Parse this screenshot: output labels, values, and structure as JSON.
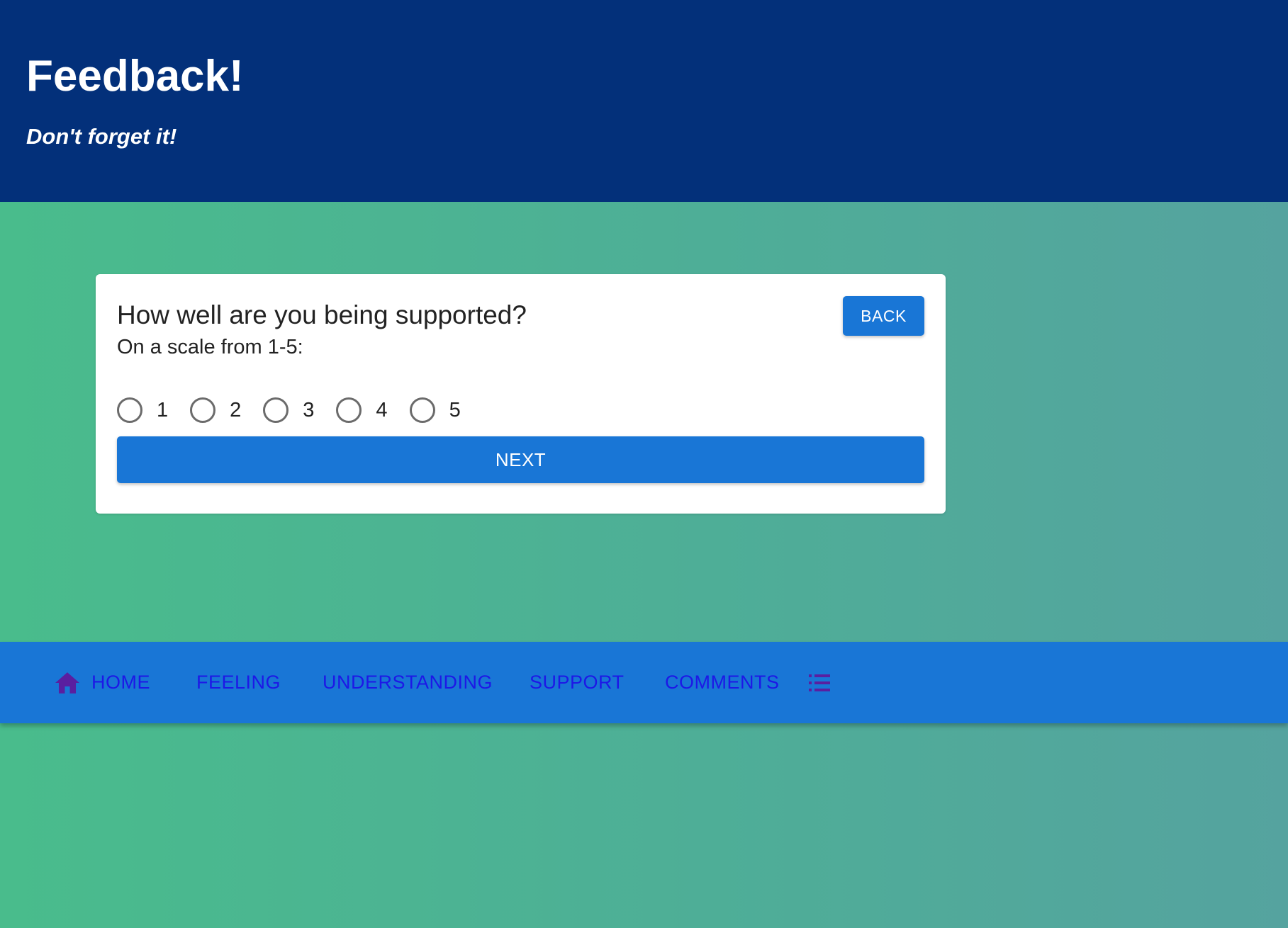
{
  "header": {
    "title": "Feedback!",
    "tagline": "Don't forget it!"
  },
  "card": {
    "question": "How well are you being supported?",
    "scale_hint": "On a scale from 1-5:",
    "back_label": "BACK",
    "next_label": "NEXT",
    "options": [
      "1",
      "2",
      "3",
      "4",
      "5"
    ],
    "selected": null
  },
  "nav": {
    "items": [
      {
        "label": "HOME",
        "icon": "home-icon"
      },
      {
        "label": "FEELING"
      },
      {
        "label": "UNDERSTANDING"
      },
      {
        "label": "SUPPORT"
      },
      {
        "label": "COMMENTS"
      }
    ],
    "list_icon": "list-icon"
  },
  "colors": {
    "header_bg": "#03307a",
    "accent": "#1976d6",
    "nav_text": "#1d18e6",
    "icon": "#5a1fa0",
    "background_start": "#49bc8c",
    "background_end": "#55a39f"
  }
}
